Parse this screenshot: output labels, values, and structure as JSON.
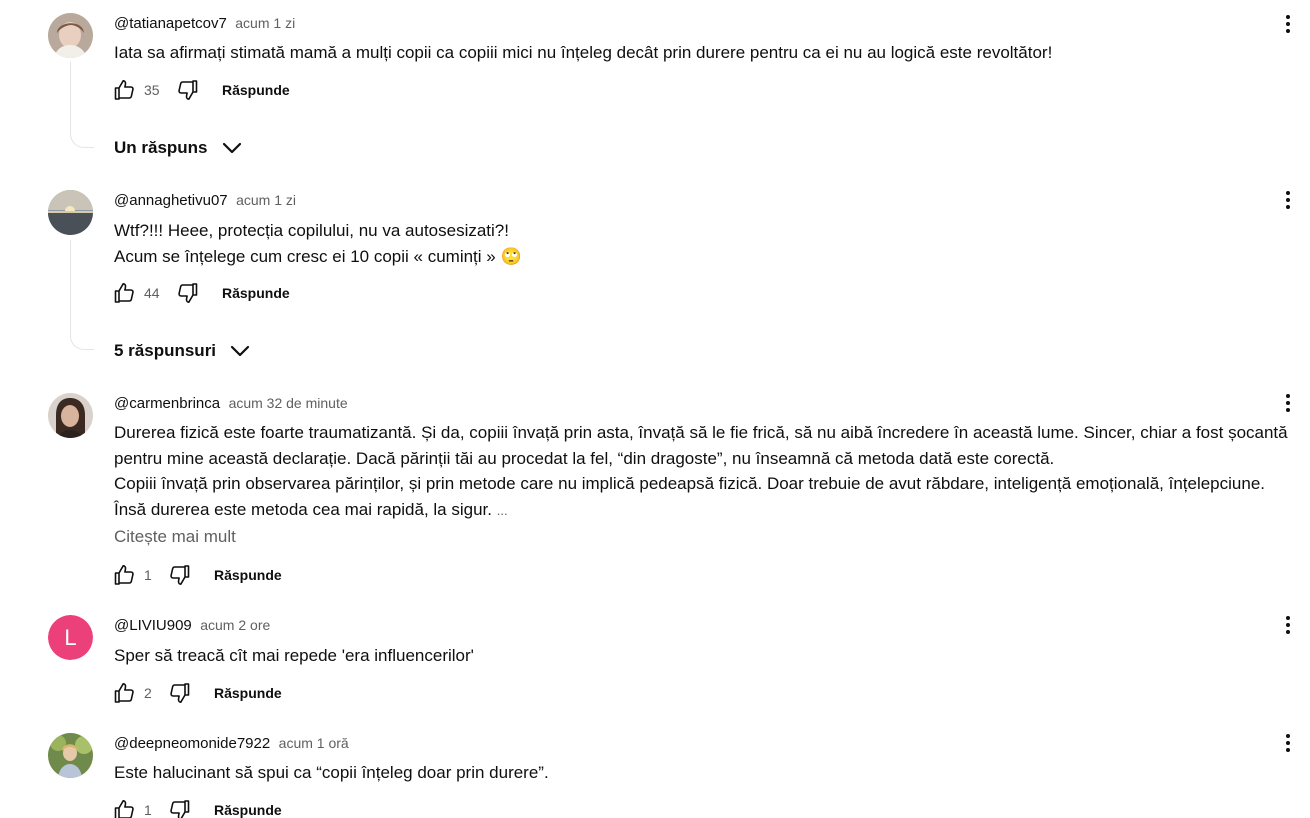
{
  "comments": [
    {
      "author": "@tatianapetcov7",
      "time": "acum 1 zi",
      "lines": [
        "Iata sa afirmați stimată mamă a mulți copii ca copiii mici nu înțeleg decât prin durere pentru ca ei nu au logică este revoltător!"
      ],
      "likes": "35",
      "reply_label": "Răspunde",
      "replies_label": "Un răspuns"
    },
    {
      "author": "@annaghetivu07",
      "time": "acum 1 zi",
      "lines": [
        "Wtf?!!! Heee, protecția copilului, nu va autosesizati?!",
        "Acum se înțelege cum cresc ei 10 copii « cuminți » 🙄"
      ],
      "likes": "44",
      "reply_label": "Răspunde",
      "replies_label": "5 răspunsuri"
    },
    {
      "author": "@carmenbrinca",
      "time": "acum 32 de minute",
      "lines": [
        "Durerea fizică este foarte traumatizantă. Și da, copiii învață prin asta, învață să le fie frică, să nu aibă încredere în această lume. Sincer, chiar a fost șocantă",
        "pentru mine această declarație. Dacă părinții tăi au procedat la fel, “din dragoste”, nu înseamnă că metoda dată este corectă.",
        "Copiii învață prin observarea părinților, și prin metode care nu implică pedeapsă fizică. Doar trebuie de avut răbdare, inteligență emoțională, înțelepciune.",
        "Însă durerea este metoda cea mai rapidă, la sigur."
      ],
      "ellipsis": "...",
      "read_more": "Citește mai mult",
      "likes": "1",
      "reply_label": "Răspunde"
    },
    {
      "author": "@LIVIU909",
      "time": "acum 2 ore",
      "avatar_letter": "L",
      "avatar_color": "#ec407a",
      "lines": [
        "Sper să treacă cît mai repede 'era influencerilor'"
      ],
      "likes": "2",
      "reply_label": "Răspunde"
    },
    {
      "author": "@deepneomonide7922",
      "time": "acum 1 oră",
      "lines": [
        "Este halucinant să spui ca “copii înțeleg doar prin durere”."
      ],
      "likes": "1",
      "reply_label": "Răspunde"
    }
  ],
  "icons": {
    "like": "thumbs-up-icon",
    "dislike": "thumbs-down-icon",
    "more": "more-vert-icon",
    "expand": "chevron-down-icon"
  }
}
